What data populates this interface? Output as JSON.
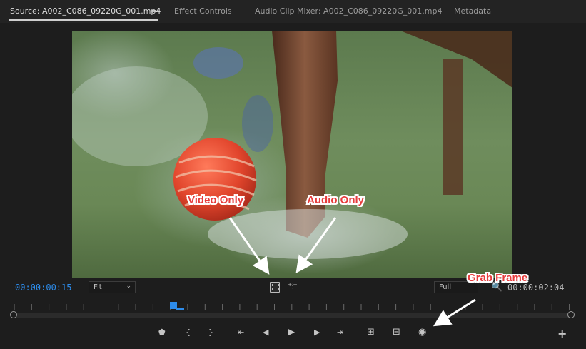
{
  "tabs": [
    {
      "label": "Source: A002_C086_09220G_001.mp4",
      "active": true
    },
    {
      "label": "Effect Controls",
      "active": false
    },
    {
      "label": "Audio Clip Mixer: A002_C086_09220G_001.mp4",
      "active": false
    },
    {
      "label": "Metadata",
      "active": false
    }
  ],
  "tab_menu_icon": "≡",
  "monitor": {
    "timecode_current": "00:00:00:15",
    "timecode_duration": "00:00:02:04",
    "zoom_select": "Fit",
    "quality_select": "Full"
  },
  "annotations": {
    "video_only": "Video Only",
    "audio_only": "Audio Only",
    "grab_frame": "Grab Frame"
  },
  "transport": {
    "marker": "⬟",
    "mark_in": "{",
    "mark_out": "}",
    "go_to_in": "⇤",
    "step_back": "◀",
    "play": "▶",
    "step_forward": "▶",
    "go_to_out": "⇥",
    "insert": "⊞",
    "overwrite": "⊟",
    "export_frame": "◉",
    "add": "+"
  },
  "icons": {
    "magnifier": "search-icon",
    "audio_only_glyph": "⁺⫶⁺"
  },
  "colors": {
    "timecode_blue": "#2d8ceb",
    "annotation_red": "#e73c3c",
    "panel_bg": "#1d1d1d"
  }
}
